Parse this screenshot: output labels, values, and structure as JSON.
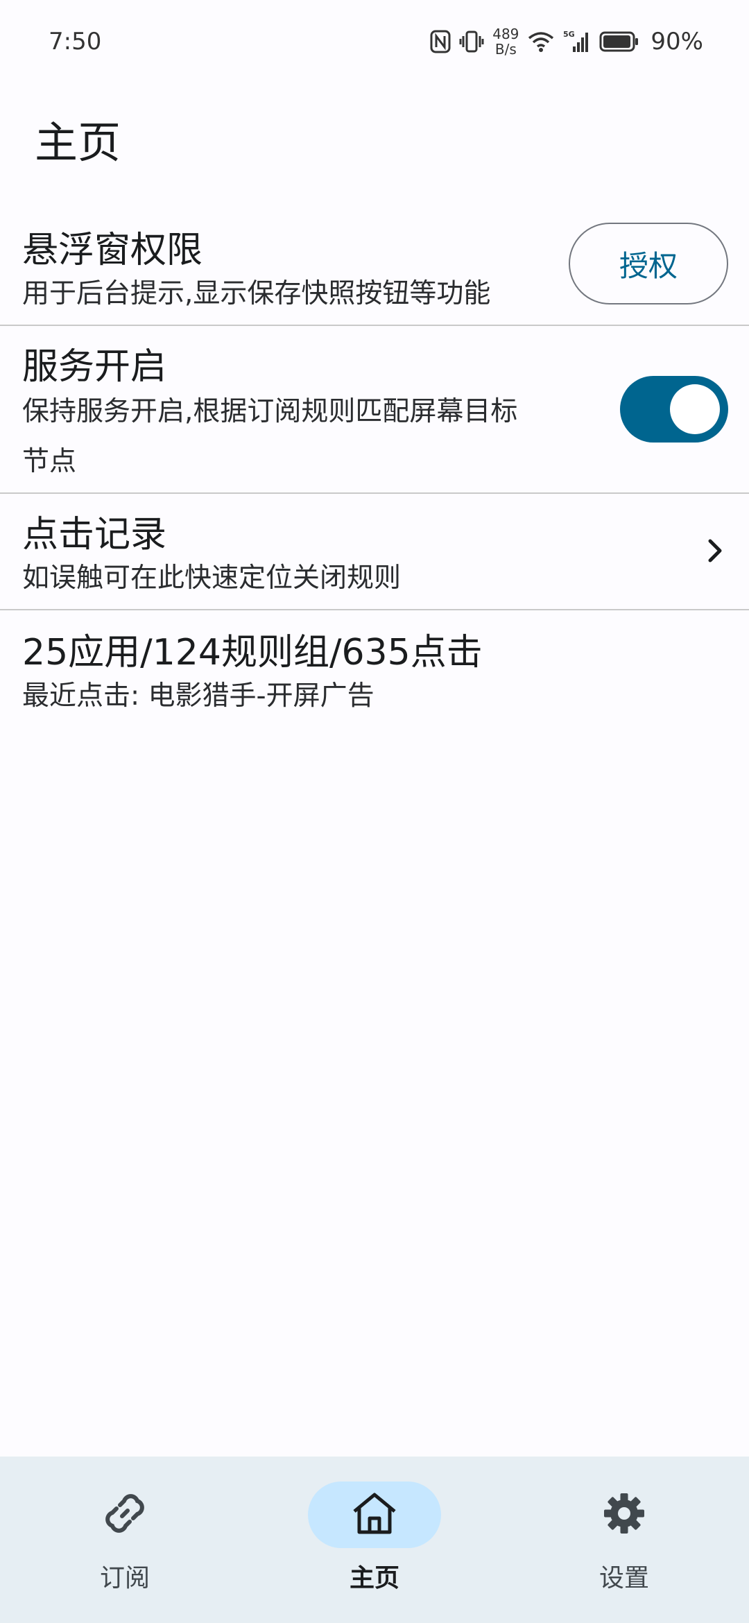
{
  "status_bar": {
    "time": "7:50",
    "speed_value": "489",
    "speed_unit": "B/s",
    "battery": "90%",
    "icons": [
      "nfc-icon",
      "vibrate-icon",
      "wifi-icon",
      "signal-5g-icon",
      "battery-icon"
    ]
  },
  "header": {
    "title": "主页"
  },
  "rows": {
    "overlay": {
      "title": "悬浮窗权限",
      "desc": "用于后台提示,显示保存快照按钮等功能",
      "button": "授权"
    },
    "service": {
      "title": "服务开启",
      "desc_line1": "保持服务开启,根据订阅规则匹配屏幕目标",
      "desc_line2": "节点",
      "enabled": true
    },
    "click_log": {
      "title": "点击记录",
      "desc": "如误触可在此快速定位关闭规则",
      "icon": "chevron-right-icon"
    },
    "stats": {
      "title": "25应用/124规则组/635点击",
      "desc": "最近点击: 电影猎手-开屏广告"
    }
  },
  "bottom_nav": {
    "items": [
      {
        "label": "订阅",
        "icon": "link-icon",
        "active": false
      },
      {
        "label": "主页",
        "icon": "home-icon",
        "active": true
      },
      {
        "label": "设置",
        "icon": "gear-icon",
        "active": false
      }
    ]
  },
  "colors": {
    "accent": "#00658f",
    "nav_background": "#e6eef3",
    "nav_active_pill": "#c6e7ff",
    "background": "#fdfcff"
  }
}
